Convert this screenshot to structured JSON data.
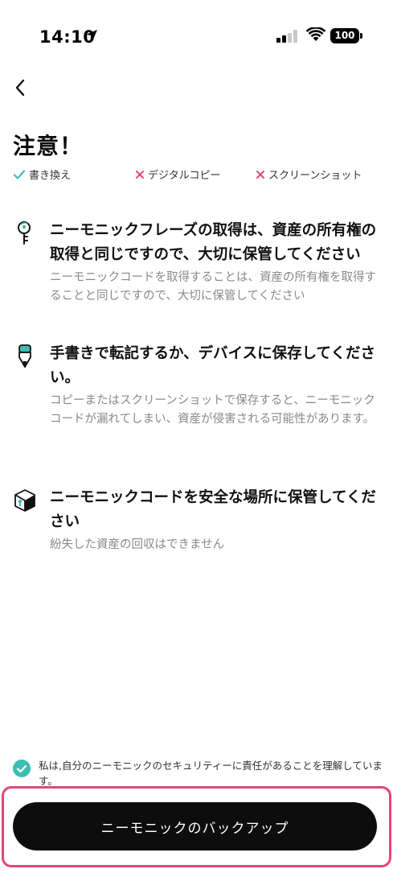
{
  "status_bar": {
    "time": "14:10",
    "battery": "100"
  },
  "page": {
    "title": "注意！"
  },
  "badges": [
    {
      "label": "書き換え",
      "status": "allowed",
      "color": "#3ebdb4"
    },
    {
      "label": "デジタルコピー",
      "status": "prohibited",
      "color": "#e4457e"
    },
    {
      "label": "スクリーンショット",
      "status": "prohibited",
      "color": "#e4457e"
    }
  ],
  "sections": [
    {
      "icon": "key-icon",
      "title": "ニーモニックフレーズの取得は、資産の所有権の取得と同じですので、大切に保管してください",
      "description": "ニーモニックコードを取得することは、資産の所有権を取得することと同じですので、大切に保管してください"
    },
    {
      "icon": "pen-icon",
      "title": "手書きで転記するか、デバイスに保存してください。",
      "description": "コピーまたはスクリーンショットで保存すると、ニーモニックコードが漏れてしまい、資産が侵害される可能性があります。"
    },
    {
      "icon": "safe-box-icon",
      "title": "ニーモニックコードを安全な場所に保管してください",
      "description": "紛失した資産の回収はできません"
    }
  ],
  "acknowledgment": {
    "checked": true,
    "text": "私は,自分のニーモニックのセキュリティーに責任があることを理解しています。"
  },
  "primary_button": {
    "label": "ニーモニックのバックアップ"
  },
  "colors": {
    "accent": "#3ebdb4",
    "danger": "#e4457e",
    "button_bg": "#0d0d0d"
  }
}
